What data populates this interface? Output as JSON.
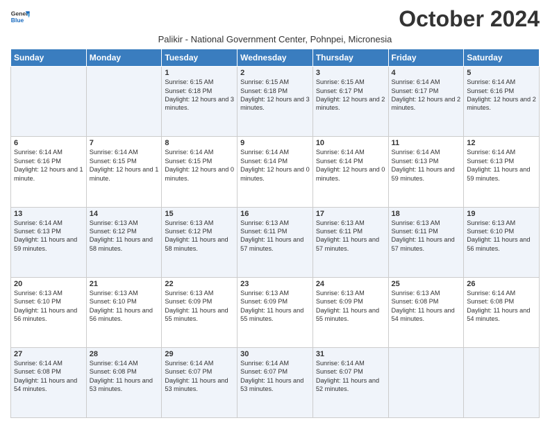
{
  "logo": {
    "general": "General",
    "blue": "Blue"
  },
  "header": {
    "month_year": "October 2024",
    "location": "Palikir - National Government Center, Pohnpei, Micronesia"
  },
  "weekdays": [
    "Sunday",
    "Monday",
    "Tuesday",
    "Wednesday",
    "Thursday",
    "Friday",
    "Saturday"
  ],
  "weeks": [
    [
      {
        "day": "",
        "info": ""
      },
      {
        "day": "",
        "info": ""
      },
      {
        "day": "1",
        "info": "Sunrise: 6:15 AM\nSunset: 6:18 PM\nDaylight: 12 hours and 3 minutes."
      },
      {
        "day": "2",
        "info": "Sunrise: 6:15 AM\nSunset: 6:18 PM\nDaylight: 12 hours and 3 minutes."
      },
      {
        "day": "3",
        "info": "Sunrise: 6:15 AM\nSunset: 6:17 PM\nDaylight: 12 hours and 2 minutes."
      },
      {
        "day": "4",
        "info": "Sunrise: 6:14 AM\nSunset: 6:17 PM\nDaylight: 12 hours and 2 minutes."
      },
      {
        "day": "5",
        "info": "Sunrise: 6:14 AM\nSunset: 6:16 PM\nDaylight: 12 hours and 2 minutes."
      }
    ],
    [
      {
        "day": "6",
        "info": "Sunrise: 6:14 AM\nSunset: 6:16 PM\nDaylight: 12 hours and 1 minute."
      },
      {
        "day": "7",
        "info": "Sunrise: 6:14 AM\nSunset: 6:15 PM\nDaylight: 12 hours and 1 minute."
      },
      {
        "day": "8",
        "info": "Sunrise: 6:14 AM\nSunset: 6:15 PM\nDaylight: 12 hours and 0 minutes."
      },
      {
        "day": "9",
        "info": "Sunrise: 6:14 AM\nSunset: 6:14 PM\nDaylight: 12 hours and 0 minutes."
      },
      {
        "day": "10",
        "info": "Sunrise: 6:14 AM\nSunset: 6:14 PM\nDaylight: 12 hours and 0 minutes."
      },
      {
        "day": "11",
        "info": "Sunrise: 6:14 AM\nSunset: 6:13 PM\nDaylight: 11 hours and 59 minutes."
      },
      {
        "day": "12",
        "info": "Sunrise: 6:14 AM\nSunset: 6:13 PM\nDaylight: 11 hours and 59 minutes."
      }
    ],
    [
      {
        "day": "13",
        "info": "Sunrise: 6:14 AM\nSunset: 6:13 PM\nDaylight: 11 hours and 59 minutes."
      },
      {
        "day": "14",
        "info": "Sunrise: 6:13 AM\nSunset: 6:12 PM\nDaylight: 11 hours and 58 minutes."
      },
      {
        "day": "15",
        "info": "Sunrise: 6:13 AM\nSunset: 6:12 PM\nDaylight: 11 hours and 58 minutes."
      },
      {
        "day": "16",
        "info": "Sunrise: 6:13 AM\nSunset: 6:11 PM\nDaylight: 11 hours and 57 minutes."
      },
      {
        "day": "17",
        "info": "Sunrise: 6:13 AM\nSunset: 6:11 PM\nDaylight: 11 hours and 57 minutes."
      },
      {
        "day": "18",
        "info": "Sunrise: 6:13 AM\nSunset: 6:11 PM\nDaylight: 11 hours and 57 minutes."
      },
      {
        "day": "19",
        "info": "Sunrise: 6:13 AM\nSunset: 6:10 PM\nDaylight: 11 hours and 56 minutes."
      }
    ],
    [
      {
        "day": "20",
        "info": "Sunrise: 6:13 AM\nSunset: 6:10 PM\nDaylight: 11 hours and 56 minutes."
      },
      {
        "day": "21",
        "info": "Sunrise: 6:13 AM\nSunset: 6:10 PM\nDaylight: 11 hours and 56 minutes."
      },
      {
        "day": "22",
        "info": "Sunrise: 6:13 AM\nSunset: 6:09 PM\nDaylight: 11 hours and 55 minutes."
      },
      {
        "day": "23",
        "info": "Sunrise: 6:13 AM\nSunset: 6:09 PM\nDaylight: 11 hours and 55 minutes."
      },
      {
        "day": "24",
        "info": "Sunrise: 6:13 AM\nSunset: 6:09 PM\nDaylight: 11 hours and 55 minutes."
      },
      {
        "day": "25",
        "info": "Sunrise: 6:13 AM\nSunset: 6:08 PM\nDaylight: 11 hours and 54 minutes."
      },
      {
        "day": "26",
        "info": "Sunrise: 6:14 AM\nSunset: 6:08 PM\nDaylight: 11 hours and 54 minutes."
      }
    ],
    [
      {
        "day": "27",
        "info": "Sunrise: 6:14 AM\nSunset: 6:08 PM\nDaylight: 11 hours and 54 minutes."
      },
      {
        "day": "28",
        "info": "Sunrise: 6:14 AM\nSunset: 6:08 PM\nDaylight: 11 hours and 53 minutes."
      },
      {
        "day": "29",
        "info": "Sunrise: 6:14 AM\nSunset: 6:07 PM\nDaylight: 11 hours and 53 minutes."
      },
      {
        "day": "30",
        "info": "Sunrise: 6:14 AM\nSunset: 6:07 PM\nDaylight: 11 hours and 53 minutes."
      },
      {
        "day": "31",
        "info": "Sunrise: 6:14 AM\nSunset: 6:07 PM\nDaylight: 11 hours and 52 minutes."
      },
      {
        "day": "",
        "info": ""
      },
      {
        "day": "",
        "info": ""
      }
    ]
  ]
}
